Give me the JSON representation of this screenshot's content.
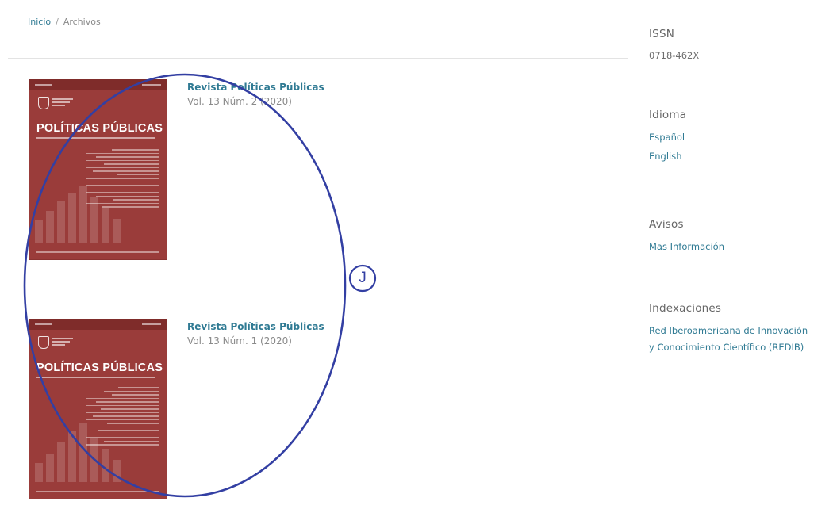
{
  "breadcrumb": {
    "home": "Inicio",
    "separator": "/",
    "current": "Archivos"
  },
  "issues": [
    {
      "title": "Revista Políticas Públicas",
      "meta": "Vol. 13 Núm. 2 (2020)",
      "cover_title": "POLÍTICAS PÚBLICAS"
    },
    {
      "title": "Revista Políticas Públicas",
      "meta": "Vol. 13 Núm. 1 (2020)",
      "cover_title": "POLÍTICAS PÚBLICAS"
    }
  ],
  "annotation": {
    "label": "J",
    "color": "#333fa3"
  },
  "sidebar": {
    "issn": {
      "title": "ISSN",
      "value": "0718-462X"
    },
    "idioma": {
      "title": "Idioma",
      "links": [
        "Español",
        "English"
      ]
    },
    "avisos": {
      "title": "Avisos",
      "links": [
        "Mas Información"
      ]
    },
    "indexaciones": {
      "title": "Indexaciones",
      "links": [
        "Red Iberoamericana de Innovación",
        "y Conocimiento Científico (REDIB)"
      ]
    }
  },
  "colors": {
    "link": "#2f7a93",
    "cover": "#9a3c3a",
    "text": "#6e6e6e"
  }
}
